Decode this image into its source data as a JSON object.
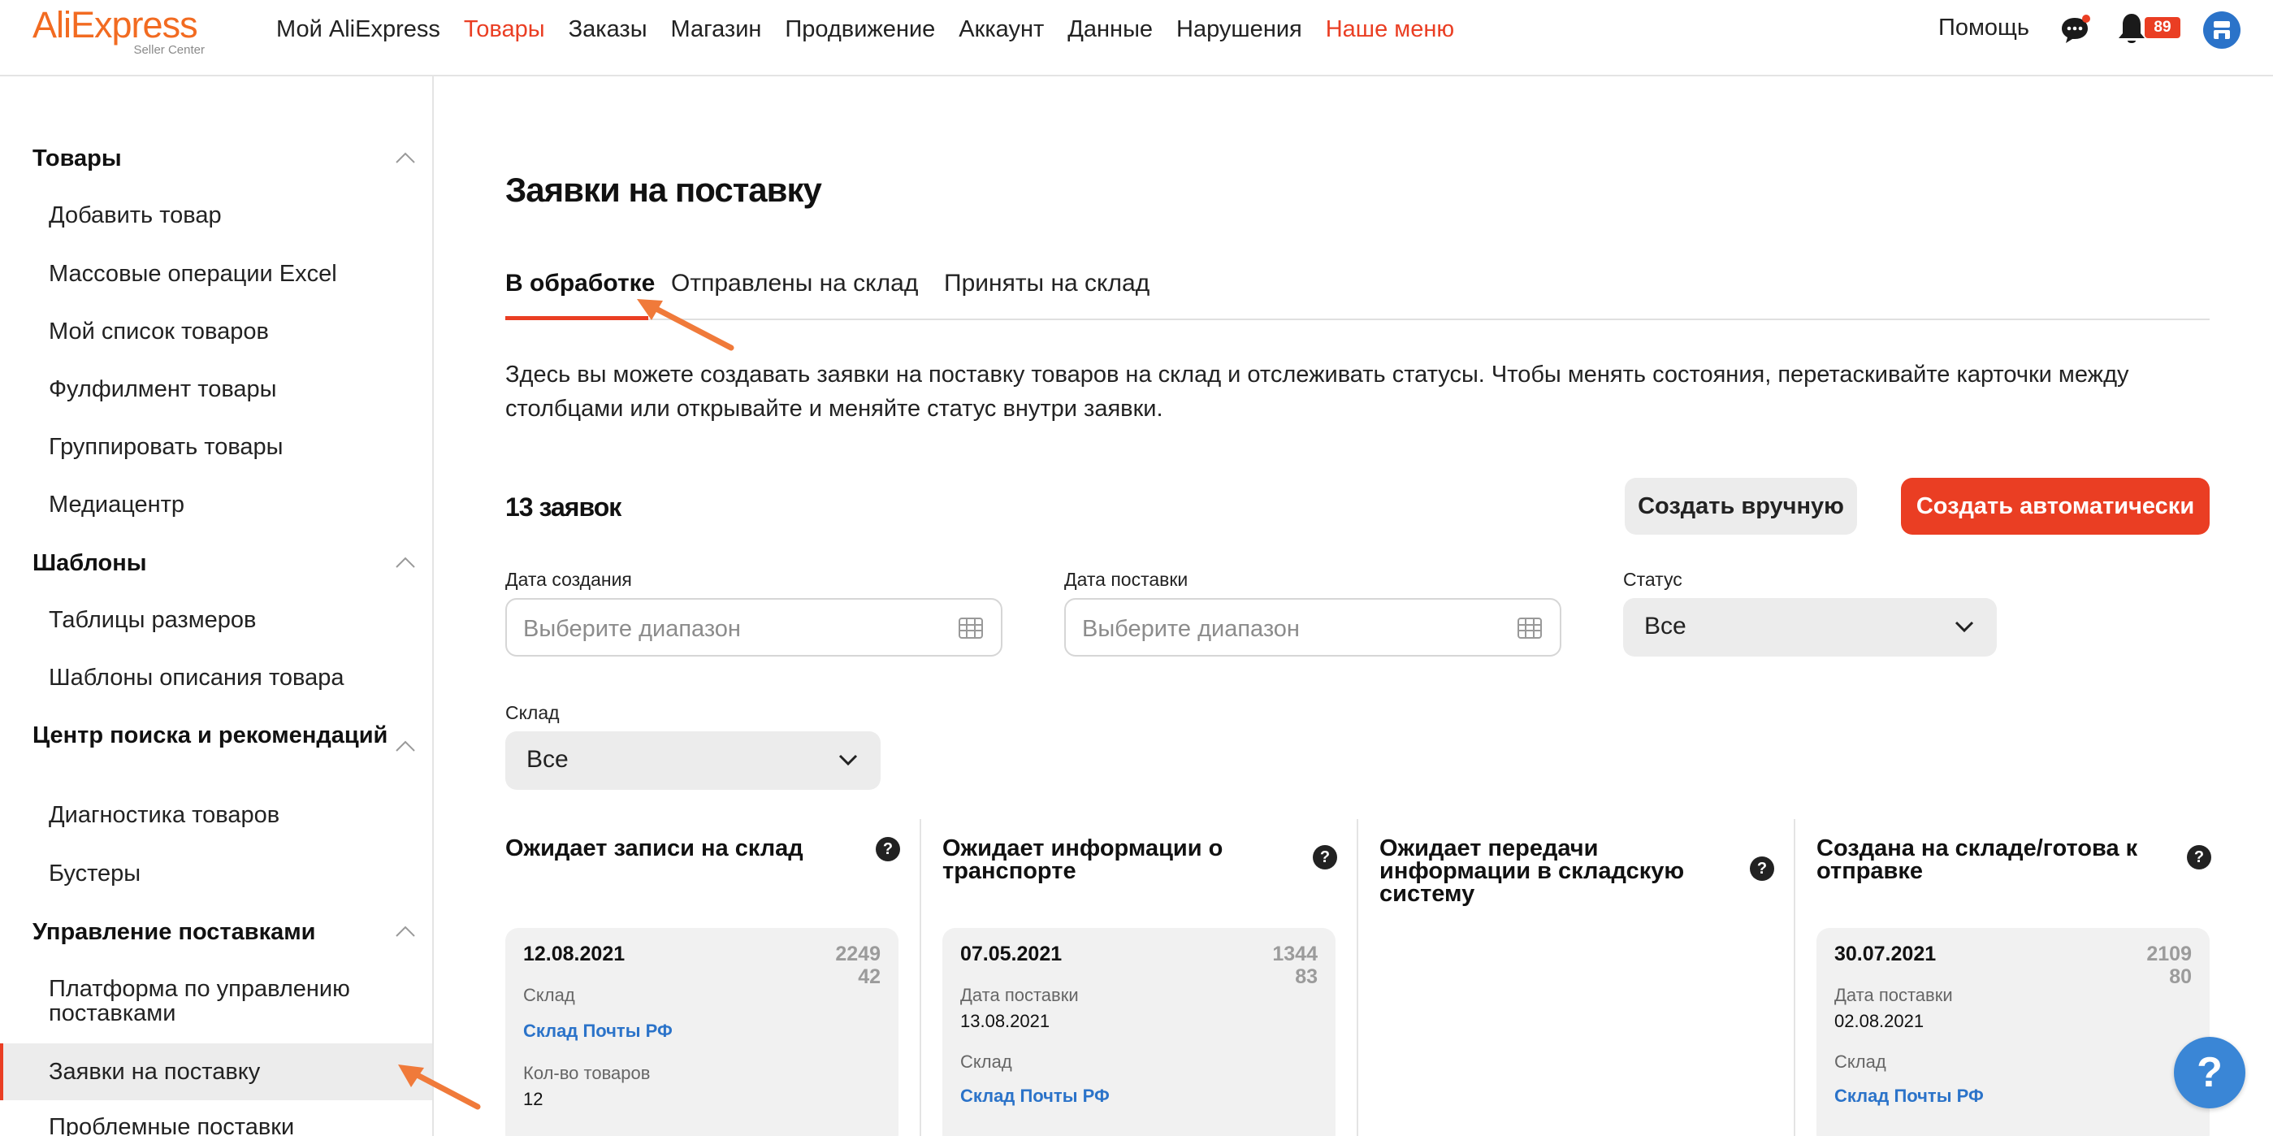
{
  "header": {
    "logo_text": "AliExpress",
    "logo_sub": "Seller Center",
    "nav": [
      {
        "label": "Мой AliExpress"
      },
      {
        "label": "Товары"
      },
      {
        "label": "Заказы"
      },
      {
        "label": "Магазин"
      },
      {
        "label": "Продвижение"
      },
      {
        "label": "Аккаунт"
      },
      {
        "label": "Данные"
      },
      {
        "label": "Нарушения"
      },
      {
        "label": "Наше меню"
      }
    ],
    "help": "Помощь",
    "notifications_count": "89"
  },
  "sidebar": {
    "groups": [
      {
        "title": "Товары",
        "items": [
          "Добавить товар",
          "Массовые операции Excel",
          "Мой список товаров",
          "Фулфилмент товары",
          "Группировать товары",
          "Медиацентр"
        ]
      },
      {
        "title": "Шаблоны",
        "items": [
          "Таблицы размеров",
          "Шаблоны описания товара"
        ]
      },
      {
        "title": "Центр поиска и рекомендаций",
        "items": [
          "Диагностика товаров",
          "Бустеры"
        ]
      },
      {
        "title": "Управление поставками",
        "items": [
          "Платформа по управлению поставками",
          "Заявки на поставку",
          "Проблемные поставки"
        ]
      }
    ],
    "active_item": "Заявки на поставку"
  },
  "main": {
    "title": "Заявки на поставку",
    "tabs": [
      "В обработке",
      "Отправлены на склад",
      "Приняты на склад"
    ],
    "active_tab": "В обработке",
    "description": "Здесь вы можете создавать заявки на поставку товаров на склад и отслеживать статусы. Чтобы менять состояния, перетаскивайте карточки между столбцами или открывайте и меняйте статус внутри заявки.",
    "count": "13 заявок",
    "btn_manual": "Создать вручную",
    "btn_auto": "Создать автоматически",
    "filters": {
      "created_label": "Дата создания",
      "created_placeholder": "Выберите диапазон",
      "delivery_label": "Дата поставки",
      "delivery_placeholder": "Выберите диапазон",
      "status_label": "Статус",
      "status_value": "Все",
      "warehouse_label": "Склад",
      "warehouse_value": "Все"
    }
  },
  "kanban": {
    "columns": [
      {
        "title": "Ожидает записи на склад"
      },
      {
        "title": "Ожидает информации о транспорте"
      },
      {
        "title": "Ожидает передачи информации в складскую систему"
      },
      {
        "title": "Создана на складе/готова к отправке"
      }
    ],
    "cards": [
      {
        "date": "12.08.2021",
        "id_line1": "2249",
        "id_line2": "42",
        "f1_label": "Склад",
        "f1_value": "Склад Почты РФ",
        "f2_label": "Кол-во товаров",
        "f2_value": "12"
      },
      {
        "date": "07.05.2021",
        "id_line1": "1344",
        "id_line2": "83",
        "f1_label": "Дата поставки",
        "f1_value": "13.08.2021",
        "f2_label": "Склад",
        "f2_value": "Склад Почты РФ"
      },
      {
        "date": "30.07.2021",
        "id_line1": "2109",
        "id_line2": "80",
        "f1_label": "Дата поставки",
        "f1_value": "02.08.2021",
        "f2_label": "Склад",
        "f2_value": "Склад Почты РФ"
      }
    ]
  },
  "help_fab": "?",
  "colors": {
    "accent": "#ea3e23",
    "link": "#2b73c9",
    "arrow": "#f07a3a"
  }
}
